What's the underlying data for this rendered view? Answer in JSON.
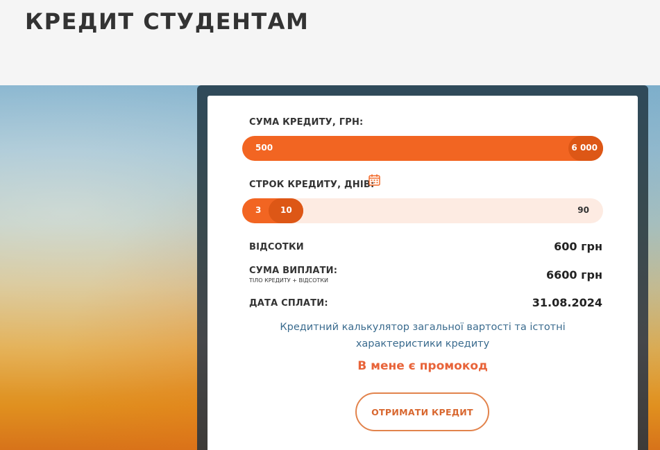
{
  "header": {
    "title": "КРЕДИТ СТУДЕНТАМ"
  },
  "calculator": {
    "amount": {
      "label": "СУМА КРЕДИТУ, ГРН:",
      "min": "500",
      "max": "6 000",
      "value_fraction": 1.0
    },
    "term": {
      "label": "СТРОК КРЕДИТУ, ДНІВ:",
      "calendar_icon": "calendar-icon",
      "min": "3",
      "current": "10",
      "max": "90",
      "value_fraction": 0.08
    },
    "interest": {
      "label": "ВІДСОТКИ",
      "value": "600 грн"
    },
    "total": {
      "label": "СУМА ВИПЛАТИ:",
      "sublabel": "ТІЛО КРЕДИТУ + ВІДСОТКИ",
      "value": "6600 грн"
    },
    "due_date": {
      "label": "ДАТА СПЛАТИ:",
      "value": "31.08.2024"
    },
    "calc_link": "Кредитний калькулятор загальної вартості та істотні характеристики кредиту",
    "promo": "В мене є промокод",
    "submit": "ОТРИМАТИ КРЕДИТ"
  },
  "colors": {
    "accent": "#f26522",
    "accent_dark": "#dd5716",
    "track": "#fdebe2",
    "link": "#3a6b8e"
  }
}
